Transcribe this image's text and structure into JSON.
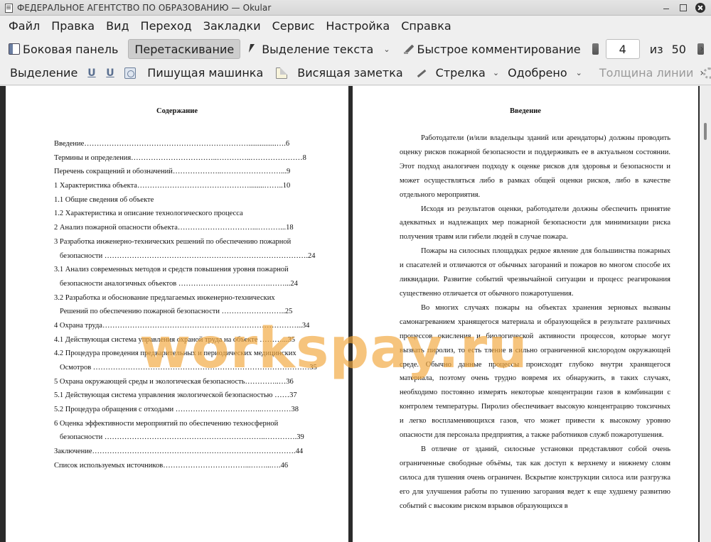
{
  "window": {
    "title": "ФЕДЕРАЛЬНОЕ АГЕНТСТВО ПО ОБРАЗОВАНИЮ  — Okular"
  },
  "menu": [
    "Файл",
    "Правка",
    "Вид",
    "Переход",
    "Закладки",
    "Сервис",
    "Настройка",
    "Справка"
  ],
  "toolbar": {
    "sidebar_label": "Боковая панель",
    "drag_label": "Перетаскивание",
    "text_select_label": "Выделение текста",
    "quick_annotate_label": "Быстрое комментирование",
    "page_current": "4",
    "page_of_label": "из",
    "page_total": "50",
    "more_glyph": "›"
  },
  "annotations_toolbar": {
    "highlight_label": "Выделение",
    "typewriter_label": "Пишущая машинка",
    "note_label": "Висящая заметка",
    "arrow_label": "Стрелка",
    "stamp_label": "Одобрено",
    "line_width_label": "Толщина линии",
    "more_glyph": "›"
  },
  "document": {
    "left_page": {
      "heading": "Содержание",
      "toc": [
        "Введение…………………………………………………………...............….6",
        "Термины и определения……………………………..…………..…………………8",
        "Перечень сокращений и обозначений………………..……………………...9",
        "1 Характеристика  объекта………………………………………........……..10",
        "1.1 Общие сведения об объекте",
        "1.2 Характеристика и описание технологического процесса",
        "2 Анализ пожарной опасности объекта…………………………...………...18",
        "3 Разработка инженерно-технических решений по обеспечению пожарной",
        "безопасности ……………………………………………………………………….24",
        "3.1 Анализ современных методов и средств повышения уровня пожарной",
        "безопасности аналогичных объектов ……………………………….……...24",
        "3.2 Разработка и обоснование предлагаемых  инженерно-технических",
        "Решений  по обеспечению пожарной безопасности ……………………..25",
        "4 Охрана труда……………………………………………………………………...34",
        "4.1 Действующая  система управления охраной труда на объекте ………...35",
        "4.2 Процедура проведения предварительных и периодических медицинских",
        "Осмотров ……………………………………………………………………………35",
        "5 Охрана окружающей среды и экологическая безопасность…………..…36",
        "5.1 Действующая система управления экологической безопасностью ……37",
        "5.2 Процедура обращения с отходами ……………………………..…………38",
        "6 Оценка эффективности мероприятий по обеспечению техносферной",
        "безопасности ………………………………………………………..………….39",
        "Заключение……………………………………………………………………….44",
        "Список используемых источников……………………………...……...….46"
      ]
    },
    "right_page": {
      "heading": "Введение",
      "paragraphs": [
        "Работодатели (и/или владельцы зданий или арендаторы) должны проводить оценку рисков пожарной безопасности и поддерживать ее в актуальном состоянии. Этот подход аналогичен подходу к оценке рисков для здоровья и безопасности и может осуществляться либо в рамках общей оценки рисков, либо в качестве отдельного мероприятия.",
        "Исходя из результатов оценки, работодатели должны обеспечить принятие адекватных и надлежащих мер пожарной безопасности для минимизации риска получения травм или гибели людей в случае пожара.",
        "Пожары на силосных площадках редкое явление для большинства пожарных и спасателей и отличаются от обычных загораний и пожаров во многом способе их ликвидации. Развитие событий чрезвычайной ситуации и процесс реагирования существенно отличается от обычного пожаротушения.",
        "Во многих случаях пожары на объектах хранения зерновых вызваны самонагреванием хранящегося материала и образующейся в результате различных процессов окисления и биологической активности процессов, которые могут вызвать пиролиз, то есть тление в сильно ограниченной кислородом окружающей среде. Обычно данные процессы происходят глубоко внутри хранящегося материала, поэтому очень трудно вовремя их обнаружить, в таких случаях, необходимо постоянно измерять некоторые концентрации газов в комбинации с контролем температуры. Пиролиз обеспечивает высокую концентрацию токсичных и легко воспламеняющихся газов, что может привести к высокому уровню опасности для персонала предприятия, а также работников служб пожаротушения.",
        "В отличие от зданий, силосные установки представляют собой очень ограниченные свободные объёмы, так как доступ к верхнему и нижнему слоям силоса для тушения очень ограничен. Вскрытие конструкции силоса или разгрузка его для улучшения работы по тушению загорания ведет к еще худшему развитию событий с высоким риском взрывов образующихся в"
      ]
    },
    "watermark": "workspay.ru"
  }
}
